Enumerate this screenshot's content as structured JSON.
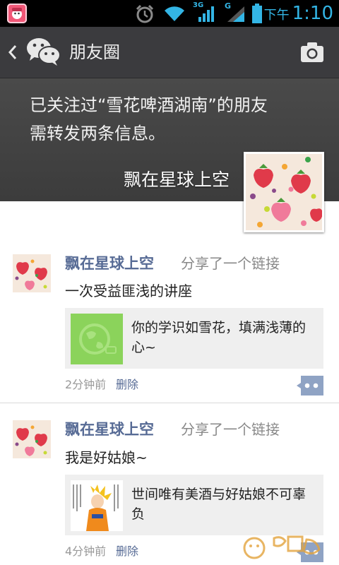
{
  "status_bar": {
    "network_3g_label": "3G",
    "network_g_label": "G",
    "ampm": "下午",
    "time": "1:10",
    "icons": [
      "app-notification-icon",
      "alarm-icon",
      "wifi-icon",
      "signal-3g-icon",
      "signal-g-icon",
      "battery-icon"
    ]
  },
  "action_bar": {
    "title": "朋友圈",
    "icons": [
      "back-chevron-icon",
      "wechat-logo-icon",
      "camera-icon"
    ]
  },
  "cover": {
    "notice_line1": "已关注过“雪花啤酒湖南”的朋友",
    "notice_line2": "需转发两条信息。",
    "user_name": "飘在星球上空"
  },
  "feed": {
    "posts": [
      {
        "user_name": "飘在星球上空",
        "action": "分享了一个链接",
        "text": "一次受益匪浅的讲座",
        "link_title": "你的学识如雪花，填满浅薄的心~",
        "time": "2分钟前",
        "delete_label": "删除"
      },
      {
        "user_name": "飘在星球上空",
        "action": "分享了一个链接",
        "text": "我是好姑娘~",
        "link_title": "世间唯有美酒与好姑娘不可辜负",
        "time": "4分钟前",
        "delete_label": "删除"
      }
    ]
  },
  "colors": {
    "accent_blue": "#33b5e5",
    "name_blue": "#576b95",
    "action_bar": "#3b3b3e",
    "link_green": "#8bd35b"
  }
}
